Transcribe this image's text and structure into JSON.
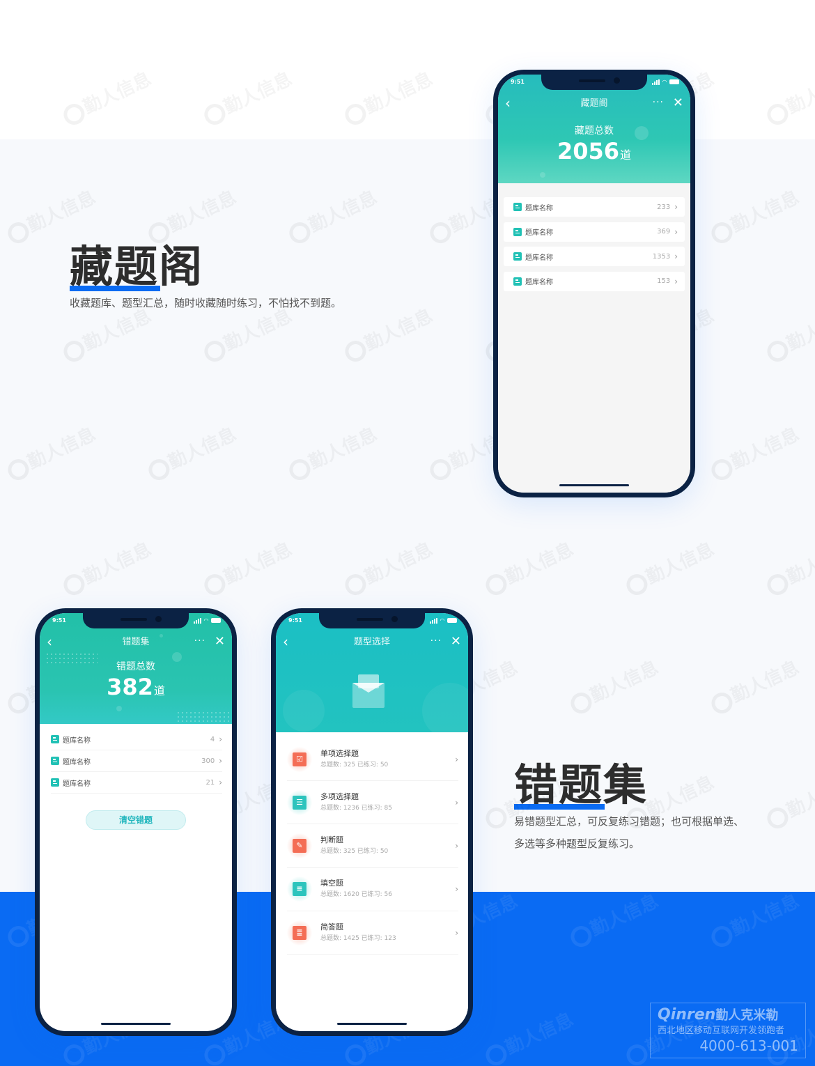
{
  "watermark": "勤人信息",
  "section_collect": {
    "heading": "藏题阁",
    "description": "收藏题库、题型汇总，随时收藏随时练习，不怕找不到题。"
  },
  "section_wrong": {
    "heading": "错题集",
    "description_line1": "易错题型汇总，可反复练习错题；也可根据单选、",
    "description_line2": "多选等多种题型反复练习。"
  },
  "status_bar": {
    "time": "9:51"
  },
  "phone_collect": {
    "title": "藏题阁",
    "summary_label": "藏题总数",
    "summary_value": "2056",
    "summary_unit": "道",
    "items": [
      {
        "name": "题库名称",
        "count": "233"
      },
      {
        "name": "题库名称",
        "count": "369"
      },
      {
        "name": "题库名称",
        "count": "1353"
      },
      {
        "name": "题库名称",
        "count": "153"
      }
    ]
  },
  "phone_wrong": {
    "title": "错题集",
    "summary_label": "错题总数",
    "summary_value": "382",
    "summary_unit": "道",
    "items": [
      {
        "name": "题库名称",
        "count": "4"
      },
      {
        "name": "题库名称",
        "count": "300"
      },
      {
        "name": "题库名称",
        "count": "21"
      }
    ],
    "clear_button": "清空错题"
  },
  "phone_types": {
    "title": "题型选择",
    "items": [
      {
        "name": "单项选择题",
        "stats": "总题数: 325   已练习: 50",
        "icon": "single-choice-icon",
        "color": "orange",
        "glyph": "☑"
      },
      {
        "name": "多项选择题",
        "stats": "总题数: 1236   已练习: 85",
        "icon": "multi-choice-icon",
        "color": "teal",
        "glyph": "☰"
      },
      {
        "name": "判断题",
        "stats": "总题数: 325   已练习: 50",
        "icon": "judgement-icon",
        "color": "orange",
        "glyph": "✎"
      },
      {
        "name": "填空题",
        "stats": "总题数: 1620   已练习: 56",
        "icon": "fill-blank-icon",
        "color": "teal",
        "glyph": "≡"
      },
      {
        "name": "简答题",
        "stats": "总题数: 1425   已练习: 123",
        "icon": "short-answer-icon",
        "color": "orange",
        "glyph": "≣"
      }
    ]
  },
  "nav_icons": {
    "back": "‹",
    "more": "···",
    "close": "✕"
  },
  "colors": {
    "accent_blue": "#0a6bf3",
    "teal": "#21c1b5",
    "orange": "#f46d55",
    "frame": "#0b2244"
  },
  "brand": {
    "logo_latin": "Qinren",
    "logo_cn": "勤人克米勒",
    "slogan": "西北地区移动互联网开发领跑者",
    "phone": "4000-613-001"
  }
}
